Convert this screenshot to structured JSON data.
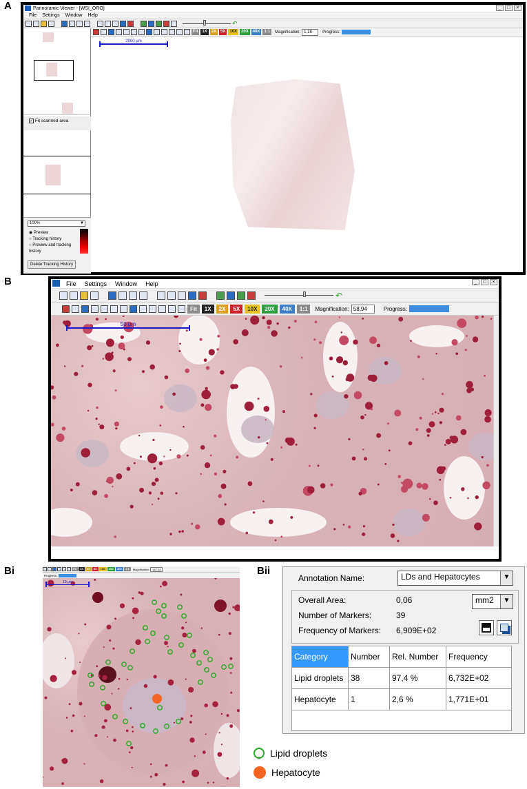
{
  "panels": {
    "a": "A",
    "b": "B",
    "bi": "Bi",
    "bii": "Bii"
  },
  "app": {
    "title": "Pannoramic Viewer - [WSI_ORO]",
    "menu": [
      "File",
      "Settings",
      "Window",
      "Help"
    ],
    "zoom_buttons": [
      {
        "label": "Fit",
        "color": "#8a8a8a"
      },
      {
        "label": "1X",
        "color": "#222222"
      },
      {
        "label": "2X",
        "color": "#d9a320"
      },
      {
        "label": "5X",
        "color": "#d0202a"
      },
      {
        "label": "10X",
        "color": "#e8c21c"
      },
      {
        "label": "20X",
        "color": "#2ea040"
      },
      {
        "label": "40X",
        "color": "#3c7fc8"
      },
      {
        "label": "1:1",
        "color": "#8a8a8a"
      }
    ],
    "magnification_label": "Magnification:",
    "progress_label": "Progress:"
  },
  "panel_a": {
    "magnification": "1,16",
    "scale_bar": "2000 µm",
    "fit_scanned_area": "Fit scanned area",
    "zoom_select": "100%",
    "radio_options": [
      "Preview",
      "Tracking history",
      "Preview and tracking history"
    ],
    "delete_button": "Delete Tracking History"
  },
  "panel_b": {
    "magnification": "58,94",
    "scale_bar": "50 µm"
  },
  "panel_bi": {
    "magnification": "167,83",
    "scale_bar": "10 µm",
    "progress_label": "Progress"
  },
  "annotation": {
    "name_label": "Annotation Name:",
    "name_value": "LDs and Hepatocytes",
    "overall_area_label": "Overall Area:",
    "overall_area_value": "0,06",
    "unit": "mm2",
    "markers_label": "Number of Markers:",
    "markers_value": "39",
    "frequency_label": "Frequency of Markers:",
    "frequency_value": "6,909E+02",
    "table": {
      "headers": [
        "Category",
        "Number",
        "Rel. Number",
        "Frequency"
      ],
      "rows": [
        [
          "Lipid droplets",
          "38",
          "97,4 %",
          "6,732E+02"
        ],
        [
          "Hepatocyte",
          "1",
          "2,6 %",
          "1,771E+01"
        ]
      ]
    }
  },
  "legend": [
    {
      "label": "Lipid droplets",
      "color": "#22aa22",
      "style": "ring"
    },
    {
      "label": "Hepatocyte",
      "color": "#f26522",
      "style": "solid"
    }
  ]
}
